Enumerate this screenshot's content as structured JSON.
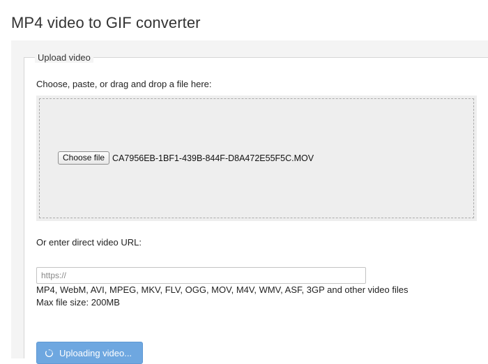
{
  "page": {
    "title": "MP4 video to GIF converter"
  },
  "upload": {
    "legend": "Upload video",
    "instruction": "Choose, paste, or drag and drop a file here:",
    "choose_file_label": "Choose file",
    "selected_file": "CA7956EB-1BF1-439B-844F-D8A472E55F5C.MOV",
    "url_label": "Or enter direct video URL:",
    "url_value": "",
    "url_placeholder": "https://",
    "formats": "MP4, WebM, AVI, MPEG, MKV, FLV, OGG, MOV, M4V, WMV, ASF, 3GP and other video files",
    "max_size": "Max file size: 200MB",
    "upload_button_label": "Uploading video...",
    "upload_button_icon": "spinner-icon"
  },
  "colors": {
    "upload_button": "#6ea7e0",
    "dropzone_bg": "#eeeeee"
  }
}
